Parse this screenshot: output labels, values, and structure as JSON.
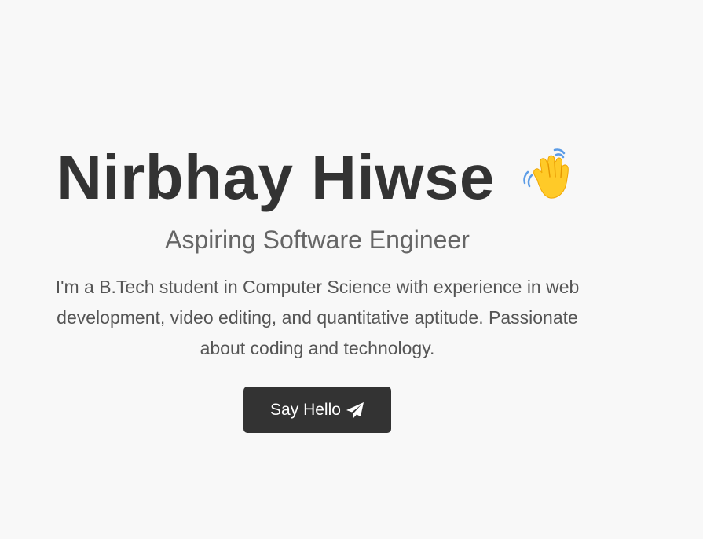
{
  "hero": {
    "name": "Nirbhay Hiwse",
    "wave_icon": "waving-hand-icon",
    "subtitle": "Aspiring Software Engineer",
    "bio": "I'm a B.Tech student in Computer Science with experience in web development, video editing, and quantitative aptitude. Passionate about coding and technology.",
    "button_label": "Say Hello",
    "button_icon": "paper-plane-icon"
  },
  "colors": {
    "background": "#f8f8f8",
    "heading": "#333333",
    "subtitle": "#666666",
    "bio": "#555555",
    "button_bg": "#333333",
    "button_text": "#ffffff",
    "wave_skin": "#FFCA28",
    "wave_motion": "#5C9CE6"
  }
}
